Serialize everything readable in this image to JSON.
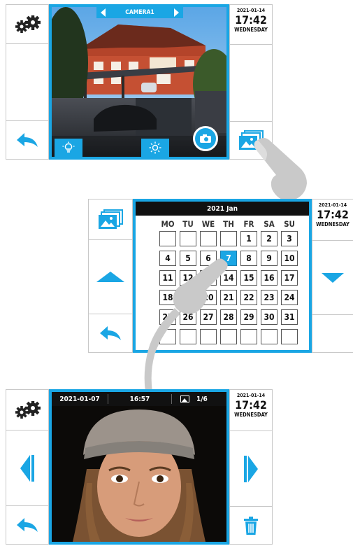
{
  "panel1": {
    "camera_label": "CAMERA1",
    "date": "2021-01-14",
    "time": "17:42",
    "weekday": "WEDNESDAY",
    "icons": {
      "settings": "gears-icon",
      "back": "back-arrow-icon",
      "gallery": "gallery-icon",
      "light": "light-bulb-icon",
      "brightness": "sun-icon",
      "snapshot": "camera-icon",
      "prev": "triangle-left-icon",
      "next": "triangle-right-icon"
    }
  },
  "panel2": {
    "month_title": "2021 Jan",
    "date": "2021-01-14",
    "time": "17:42",
    "weekday": "WEDNESDAY",
    "weekdays": [
      "MO",
      "TU",
      "WE",
      "TH",
      "FR",
      "SA",
      "SU"
    ],
    "days": [
      [
        "",
        "",
        "",
        "",
        "1",
        "2",
        "3"
      ],
      [
        "4",
        "5",
        "6",
        "7",
        "8",
        "9",
        "10"
      ],
      [
        "11",
        "12",
        "13",
        "14",
        "15",
        "16",
        "17"
      ],
      [
        "18",
        "19",
        "20",
        "21",
        "22",
        "23",
        "24"
      ],
      [
        "25",
        "26",
        "27",
        "28",
        "29",
        "30",
        "31"
      ],
      [
        "",
        "",
        "",
        "",
        "",
        "",
        ""
      ]
    ],
    "selected_day": "7",
    "icons": {
      "gallery": "gallery-icon",
      "up": "triangle-up-icon",
      "down": "triangle-down-icon",
      "back": "back-arrow-icon"
    }
  },
  "panel3": {
    "photo_date": "2021-01-07",
    "photo_time": "16:57",
    "photo_count": "1/6",
    "date": "2021-01-14",
    "time": "17:42",
    "weekday": "WEDNESDAY",
    "icons": {
      "settings": "gears-icon",
      "prev": "triangle-left-icon",
      "next": "triangle-right-icon",
      "back": "back-arrow-icon",
      "delete": "trash-icon",
      "photo": "image-icon"
    }
  },
  "colors": {
    "accent": "#1aa6e4",
    "header": "#111111"
  }
}
